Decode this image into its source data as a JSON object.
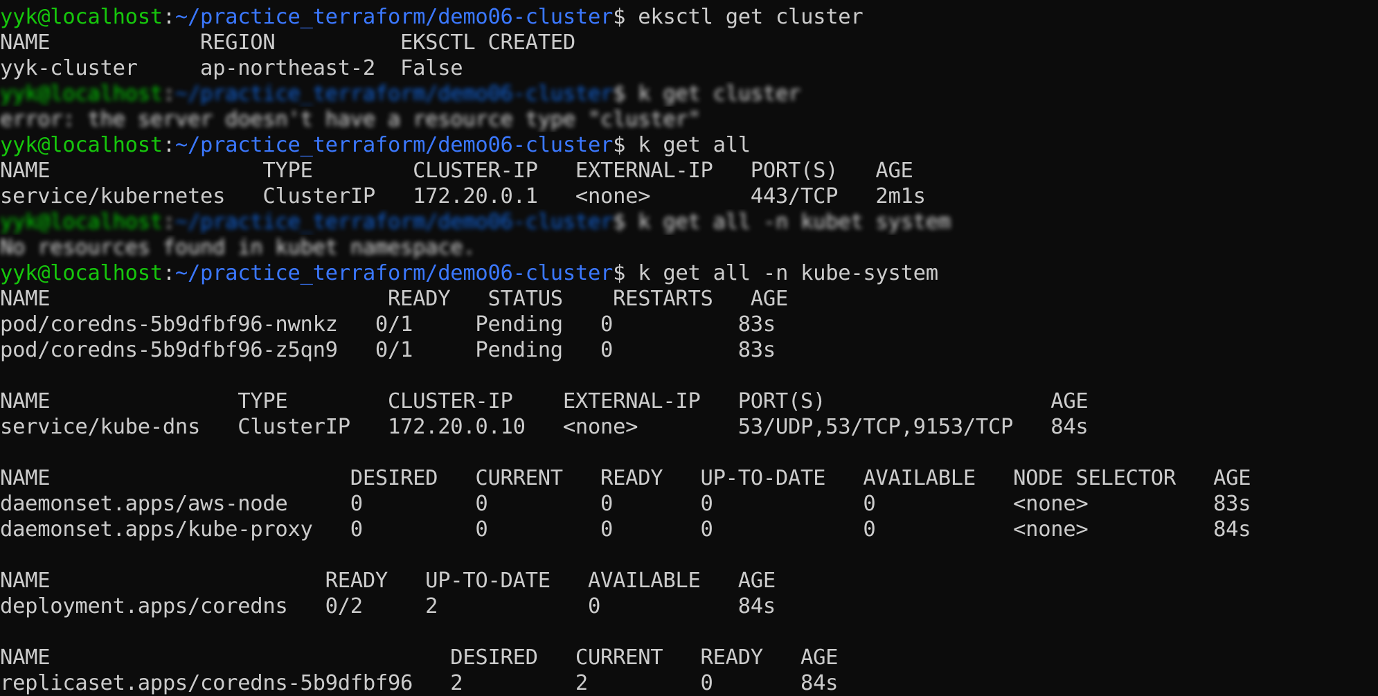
{
  "terminal": {
    "colors": {
      "background": "#0c0c0c",
      "text": "#cccccc",
      "user": "#16c60c",
      "path": "#3b78ff"
    },
    "prompt": {
      "user_host": "yyk@localhost",
      "colon": ":",
      "path": "~/practice_terraform/demo06-cluster",
      "symbol": "$ "
    },
    "lines": [
      {
        "kind": "prompt",
        "command": "eksctl get cluster"
      },
      {
        "kind": "out",
        "text": "NAME            REGION          EKSCTL CREATED"
      },
      {
        "kind": "out",
        "text": "yyk-cluster     ap-northeast-2  False"
      },
      {
        "kind": "blur-prompt",
        "command": "k get cluster"
      },
      {
        "kind": "blur-out",
        "text": "error: the server doesn't have a resource type \"cluster\""
      },
      {
        "kind": "prompt",
        "command": "k get all"
      },
      {
        "kind": "out",
        "text": "NAME                 TYPE        CLUSTER-IP   EXTERNAL-IP   PORT(S)   AGE"
      },
      {
        "kind": "out",
        "text": "service/kubernetes   ClusterIP   172.20.0.1   <none>        443/TCP   2m1s"
      },
      {
        "kind": "blur-prompt",
        "command": "k get all -n kubet system"
      },
      {
        "kind": "blur-out",
        "text": "No resources found in kubet namespace."
      },
      {
        "kind": "prompt",
        "command": "k get all -n kube-system"
      },
      {
        "kind": "out",
        "text": "NAME                           READY   STATUS    RESTARTS   AGE"
      },
      {
        "kind": "out",
        "text": "pod/coredns-5b9dfbf96-nwnkz   0/1     Pending   0          83s"
      },
      {
        "kind": "out",
        "text": "pod/coredns-5b9dfbf96-z5qn9   0/1     Pending   0          83s"
      },
      {
        "kind": "blank",
        "text": ""
      },
      {
        "kind": "out",
        "text": "NAME               TYPE        CLUSTER-IP    EXTERNAL-IP   PORT(S)                  AGE"
      },
      {
        "kind": "out",
        "text": "service/kube-dns   ClusterIP   172.20.0.10   <none>        53/UDP,53/TCP,9153/TCP   84s"
      },
      {
        "kind": "blank",
        "text": ""
      },
      {
        "kind": "out",
        "text": "NAME                        DESIRED   CURRENT   READY   UP-TO-DATE   AVAILABLE   NODE SELECTOR   AGE"
      },
      {
        "kind": "out",
        "text": "daemonset.apps/aws-node     0         0         0       0            0           <none>          83s"
      },
      {
        "kind": "out",
        "text": "daemonset.apps/kube-proxy   0         0         0       0            0           <none>          84s"
      },
      {
        "kind": "blank",
        "text": ""
      },
      {
        "kind": "out",
        "text": "NAME                      READY   UP-TO-DATE   AVAILABLE   AGE"
      },
      {
        "kind": "out",
        "text": "deployment.apps/coredns   0/2     2            0           84s"
      },
      {
        "kind": "blank",
        "text": ""
      },
      {
        "kind": "out",
        "text": "NAME                                DESIRED   CURRENT   READY   AGE"
      },
      {
        "kind": "out",
        "text": "replicaset.apps/coredns-5b9dfbf96   2         2         0       84s"
      }
    ]
  }
}
